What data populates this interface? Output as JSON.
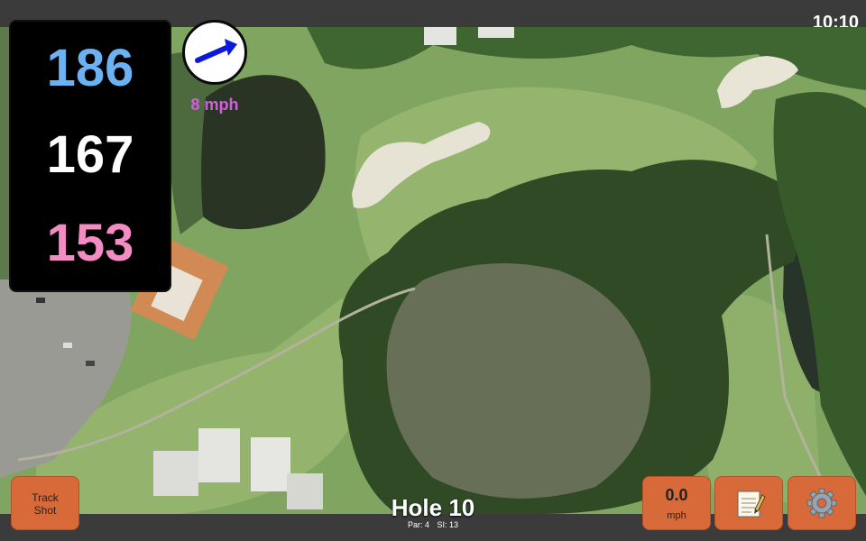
{
  "clock": "10:10",
  "distances": {
    "back": "186",
    "middle": "167",
    "front": "153",
    "colors": {
      "back": "#6ab2f2",
      "middle": "#ffffff",
      "front": "#f48cc4"
    }
  },
  "wind": {
    "speed_label": "8 mph",
    "arrow_icon": "arrow-right-icon",
    "color": "#d15fe0"
  },
  "hole": {
    "title": "Hole 10",
    "par": "Par: 4",
    "si": "SI: 13"
  },
  "buttons": {
    "track_shot_line1": "Track",
    "track_shot_line2": "Shot",
    "speed_value": "0.0",
    "speed_unit": "mph",
    "notes_icon": "notepad-icon",
    "settings_icon": "gear-icon"
  },
  "colors": {
    "button": "#d86a3a",
    "bar": "#3b3b3b",
    "panel": "#000000"
  }
}
